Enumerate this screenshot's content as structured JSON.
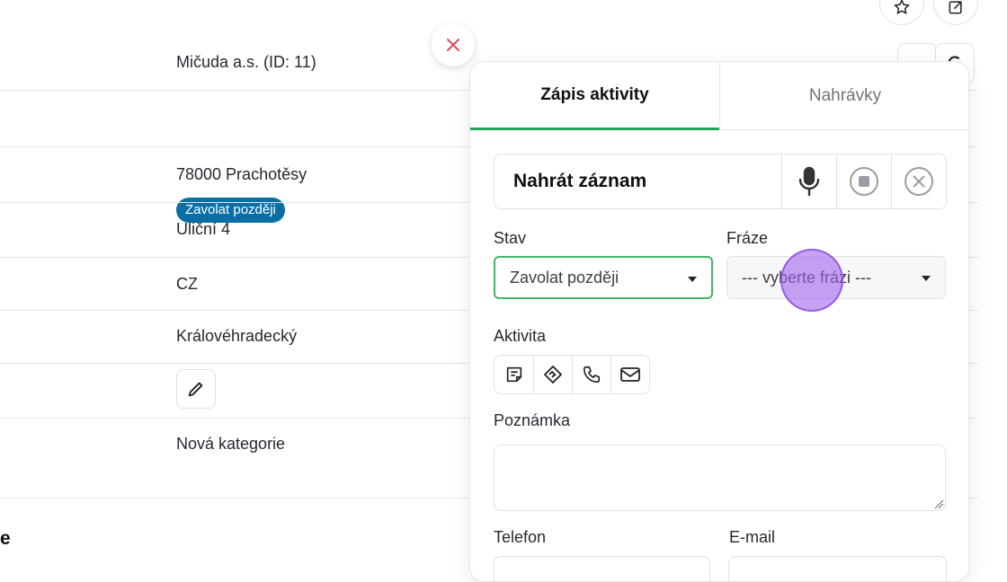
{
  "background": {
    "rows": [
      {
        "value": "Mičuda a.s. (ID: 11)"
      },
      {
        "badge": "Zavolat později"
      },
      {
        "value": "78000 Prachotěsy"
      },
      {
        "value": "Uliční 4"
      },
      {
        "value": "CZ"
      },
      {
        "value": "Královéhradecký"
      },
      {
        "value": ""
      },
      {
        "value": "Nová kategorie"
      }
    ],
    "section_heading_partial": "e"
  },
  "panel": {
    "tabs": {
      "active": "Zápis aktivity",
      "inactive": "Nahrávky"
    },
    "record": {
      "label": "Nahrát záznam"
    },
    "state": {
      "label": "Stav",
      "selected": "Zavolat později"
    },
    "phrase": {
      "label": "Fráze",
      "selected": "--- vyberte frázi ---"
    },
    "activity": {
      "label": "Aktivita",
      "types": [
        "note-icon",
        "handshake-icon",
        "phone-icon",
        "mail-icon"
      ]
    },
    "note": {
      "label": "Poznámka",
      "value": ""
    },
    "phone": {
      "label": "Telefon"
    },
    "email": {
      "label": "E-mail"
    }
  },
  "colors": {
    "badge": "#0b6fa6",
    "active_tab_underline": "#22a355",
    "close_x": "#d64a5a"
  }
}
